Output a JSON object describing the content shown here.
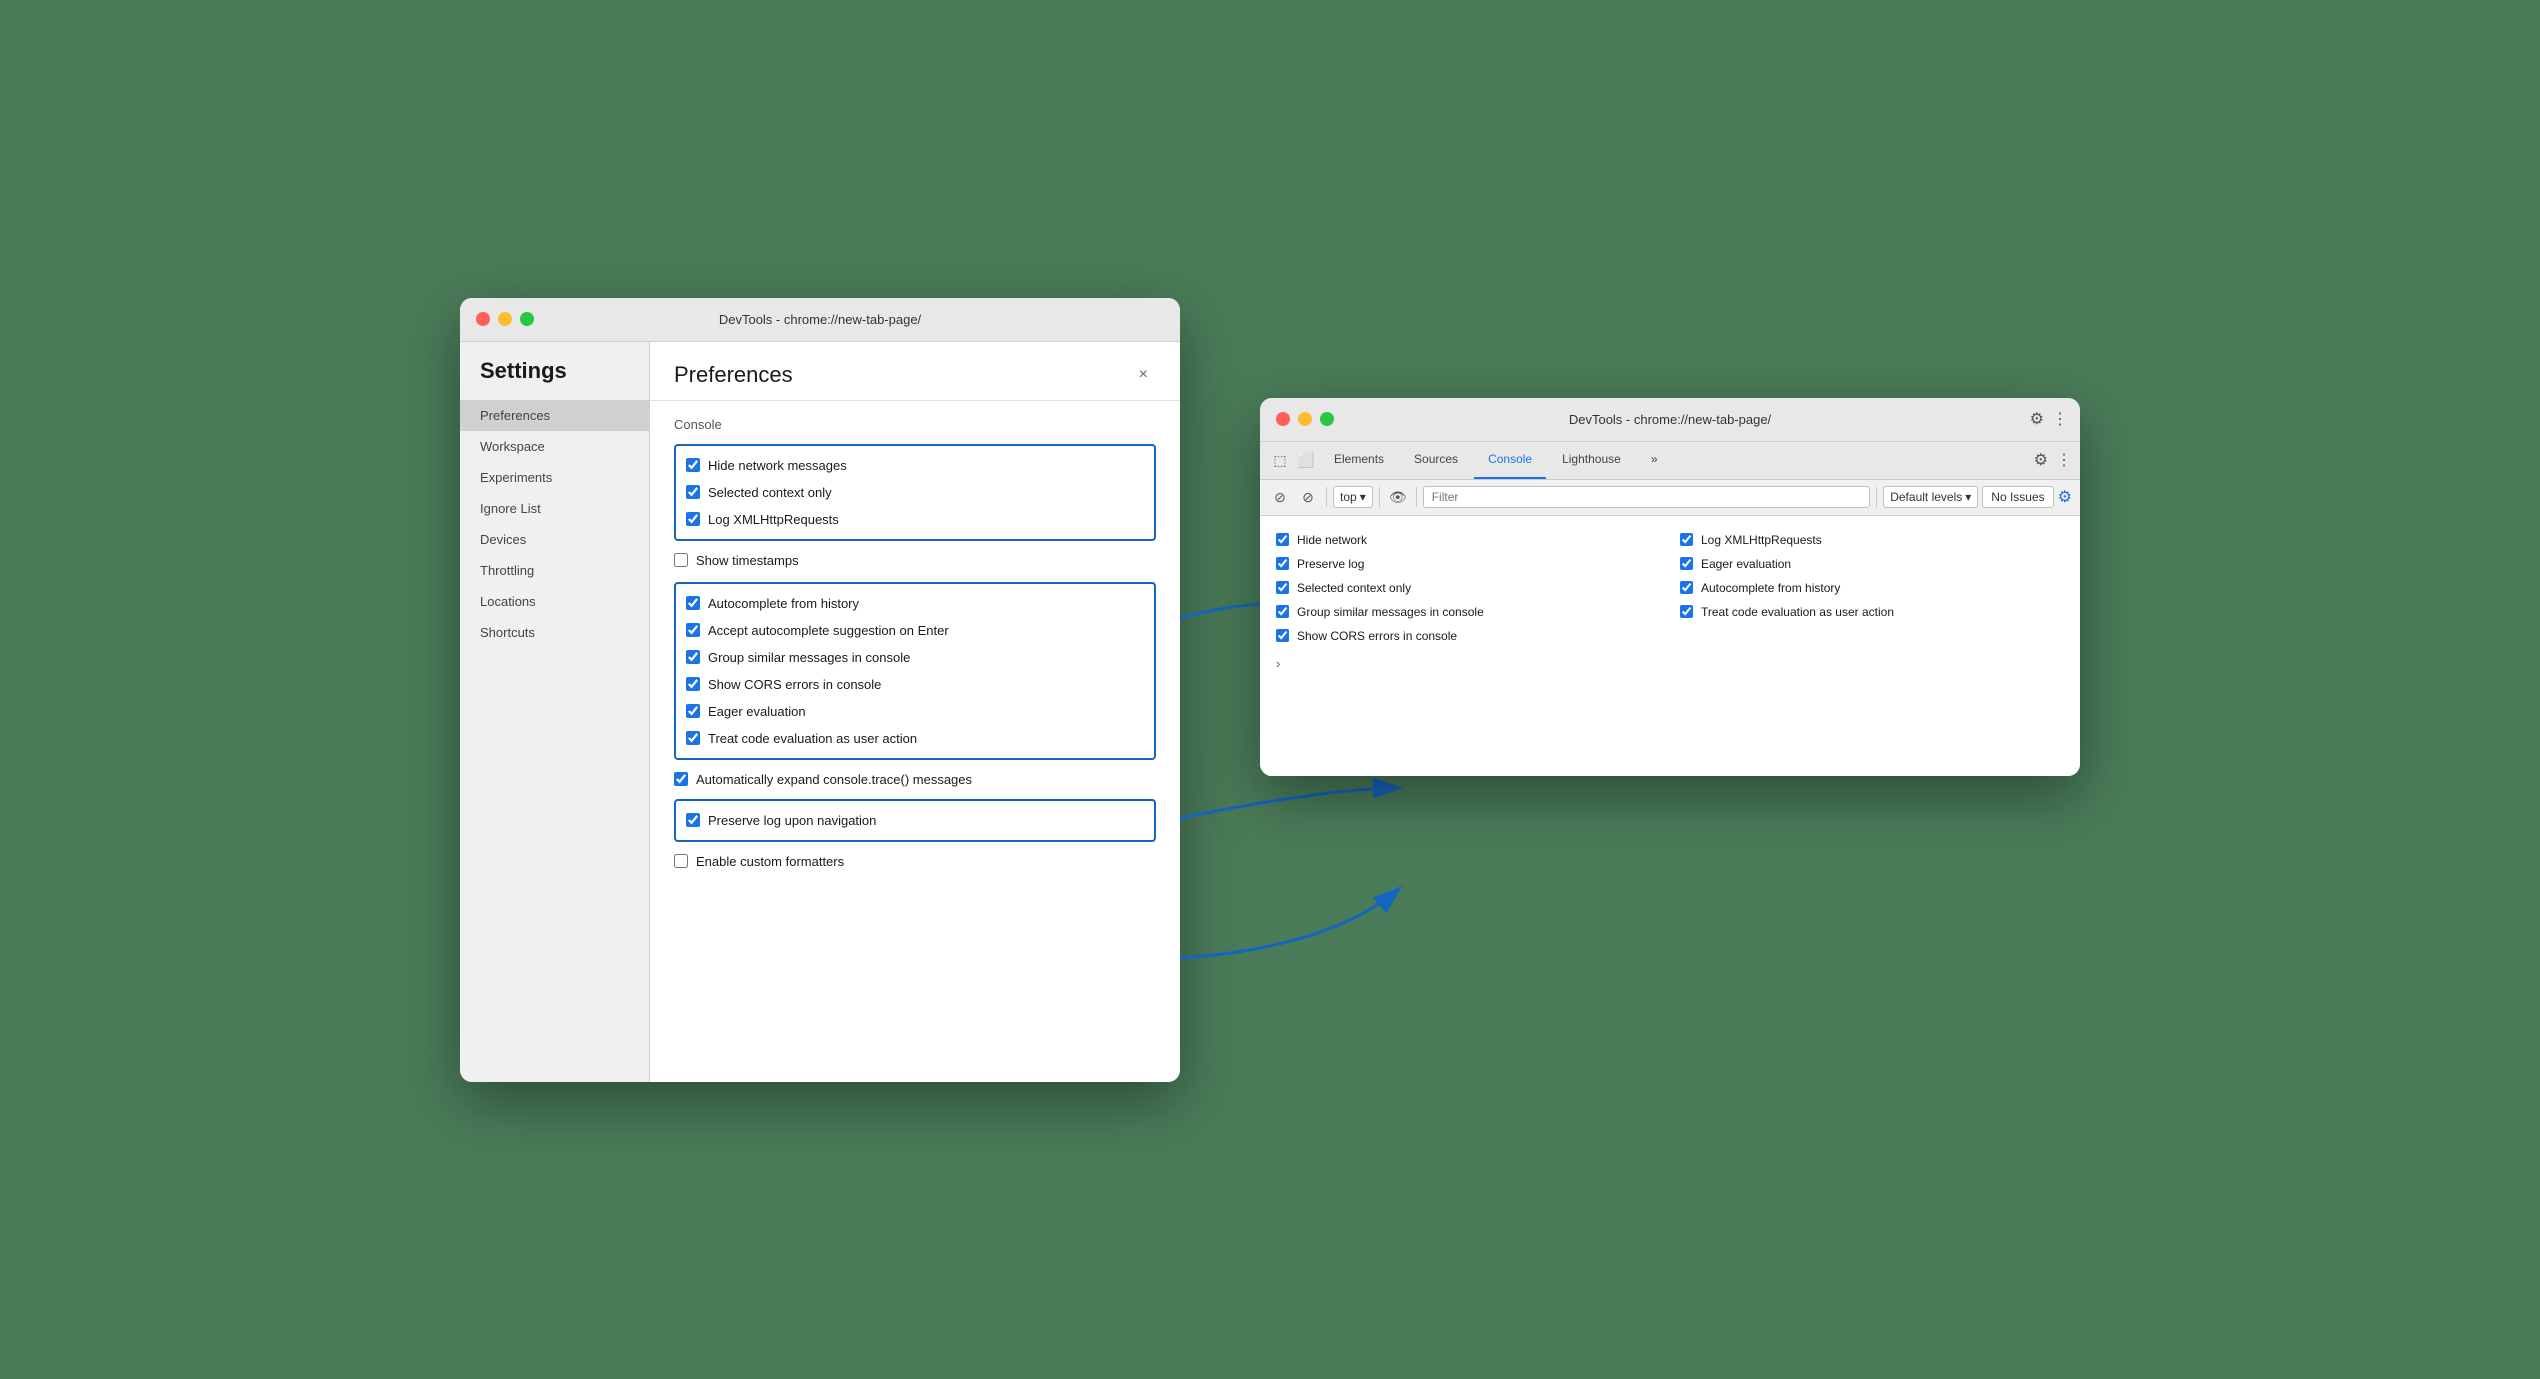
{
  "scene": {
    "background": "#4a7c59"
  },
  "settingsWindow": {
    "titlebar": {
      "title": "DevTools - chrome://new-tab-page/"
    },
    "sidebar": {
      "heading": "Settings",
      "items": [
        {
          "label": "Preferences",
          "active": true
        },
        {
          "label": "Workspace",
          "active": false
        },
        {
          "label": "Experiments",
          "active": false
        },
        {
          "label": "Ignore List",
          "active": false
        },
        {
          "label": "Devices",
          "active": false
        },
        {
          "label": "Throttling",
          "active": false
        },
        {
          "label": "Locations",
          "active": false
        },
        {
          "label": "Shortcuts",
          "active": false
        }
      ]
    },
    "main": {
      "title": "Preferences",
      "close_label": "×",
      "section_label": "Console",
      "group1": {
        "items": [
          {
            "label": "Hide network messages",
            "checked": true
          },
          {
            "label": "Selected context only",
            "checked": true
          },
          {
            "label": "Log XMLHttpRequests",
            "checked": true
          }
        ]
      },
      "standalone": [
        {
          "label": "Show timestamps",
          "checked": false
        }
      ],
      "group2": {
        "items": [
          {
            "label": "Autocomplete from history",
            "checked": true
          },
          {
            "label": "Accept autocomplete suggestion on Enter",
            "checked": true
          },
          {
            "label": "Group similar messages in console",
            "checked": true
          },
          {
            "label": "Show CORS errors in console",
            "checked": true
          },
          {
            "label": "Eager evaluation",
            "checked": true
          },
          {
            "label": "Treat code evaluation as user action",
            "checked": true
          }
        ]
      },
      "standalone2": [
        {
          "label": "Automatically expand console.trace() messages",
          "checked": true
        }
      ],
      "group3": {
        "items": [
          {
            "label": "Preserve log upon navigation",
            "checked": true
          }
        ]
      },
      "standalone3": [
        {
          "label": "Enable custom formatters",
          "checked": false
        }
      ]
    }
  },
  "devtoolsWindow": {
    "titlebar": {
      "title": "DevTools - chrome://new-tab-page/"
    },
    "tabs": [
      {
        "label": "Elements",
        "icon": "⬜",
        "active": false
      },
      {
        "label": "Sources",
        "active": false
      },
      {
        "label": "Console",
        "active": true
      },
      {
        "label": "Lighthouse",
        "active": false
      },
      {
        "label": "»",
        "active": false
      }
    ],
    "toolbar": {
      "top_label": "top",
      "filter_placeholder": "Filter",
      "levels_label": "Default levels",
      "issues_label": "No Issues"
    },
    "console": {
      "col1": [
        {
          "label": "Hide network",
          "checked": true
        },
        {
          "label": "Preserve log",
          "checked": true
        },
        {
          "label": "Selected context only",
          "checked": true
        },
        {
          "label": "Group similar messages in console",
          "checked": true
        },
        {
          "label": "Show CORS errors in console",
          "checked": true
        }
      ],
      "col2": [
        {
          "label": "Log XMLHttpRequests",
          "checked": true
        },
        {
          "label": "Eager evaluation",
          "checked": true
        },
        {
          "label": "Autocomplete from history",
          "checked": true
        },
        {
          "label": "Treat code evaluation as user action",
          "checked": true
        }
      ]
    }
  }
}
